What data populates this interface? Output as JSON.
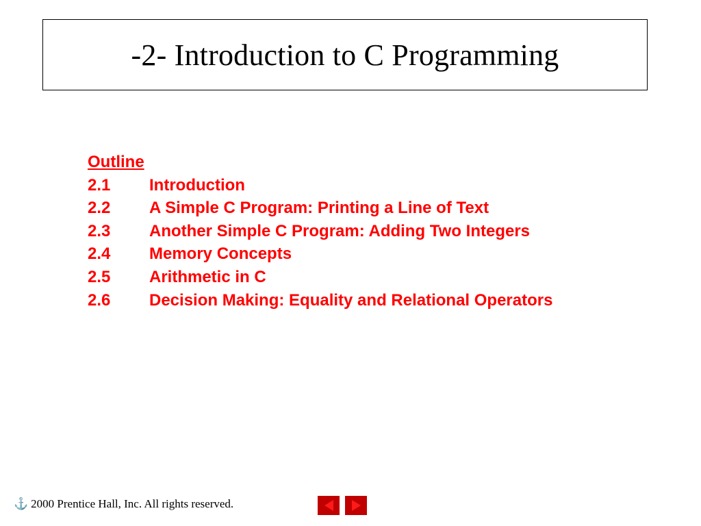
{
  "title": "-2- Introduction to C Programming",
  "outline": {
    "heading": "Outline",
    "items": [
      {
        "num": "2.1",
        "label": "Introduction"
      },
      {
        "num": "2.2",
        "label": "A Simple C Program: Printing a Line of Text"
      },
      {
        "num": "2.3",
        "label": "Another Simple C Program: Adding Two Integers"
      },
      {
        "num": "2.4",
        "label": "Memory Concepts"
      },
      {
        "num": "2.5",
        "label": "Arithmetic in C"
      },
      {
        "num": "2.6",
        "label": "Decision Making: Equality and Relational Operators"
      }
    ]
  },
  "footer": {
    "copyright": "2000 Prentice Hall, Inc.  All rights reserved."
  }
}
